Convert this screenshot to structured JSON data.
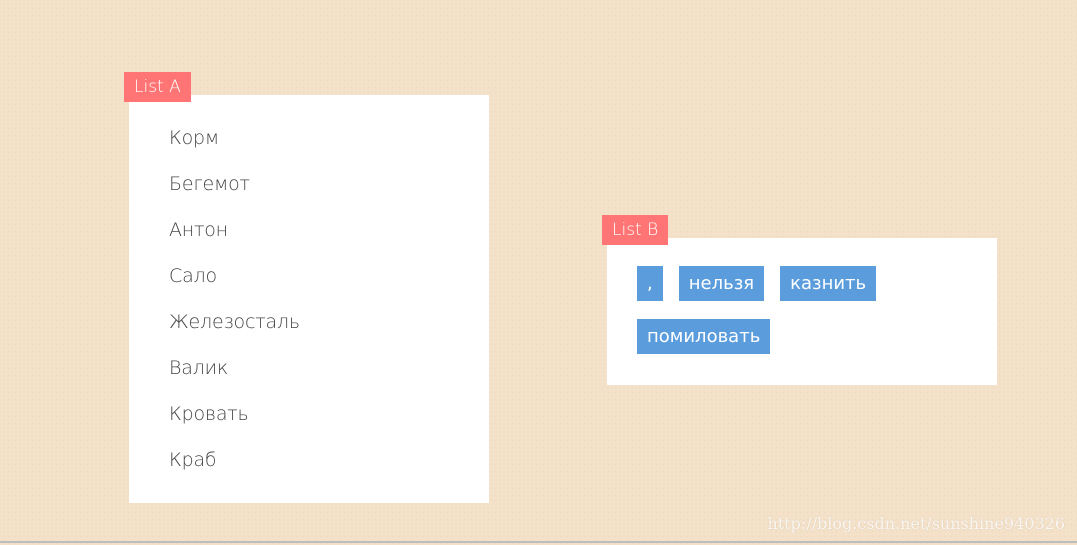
{
  "list_a": {
    "label": "List A",
    "items": [
      "Корм",
      "Бегемот",
      "Антон",
      "Сало",
      "Железосталь",
      "Валик",
      "Кровать",
      "Краб"
    ]
  },
  "list_b": {
    "label": "List B",
    "items": [
      ",",
      "нельзя",
      "казнить",
      "помиловать"
    ]
  },
  "watermark": "http://blog.csdn.net/sunshine940326",
  "colors": {
    "background": "#f3e0c7",
    "tag": "#ff7575",
    "chip": "#5b9ddc",
    "panel": "#ffffff"
  }
}
